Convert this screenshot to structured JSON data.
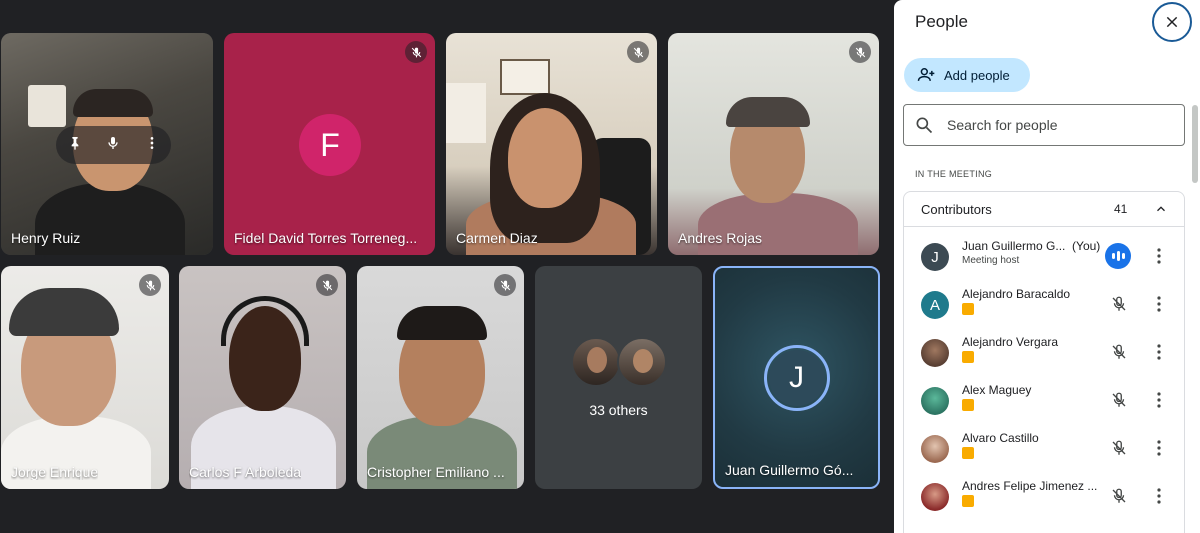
{
  "grid": {
    "tiles": [
      {
        "name": "Henry Ruiz"
      },
      {
        "name": "Fidel David Torres Torreneg...",
        "initial": "F"
      },
      {
        "name": "Carmen Diaz"
      },
      {
        "name": "Andres Rojas"
      },
      {
        "name": "Jorge Enrique"
      },
      {
        "name": "Carlos F Arboleda"
      },
      {
        "name": "Cristopher Emiliano ..."
      },
      {
        "others_label": "33 others"
      },
      {
        "name": "Juan Guillermo Gó...",
        "initial": "J"
      }
    ]
  },
  "panel": {
    "title": "People",
    "add_people_label": "Add people",
    "search_placeholder": "Search for people",
    "section_label": "IN THE MEETING",
    "group": {
      "title": "Contributors",
      "count": "41",
      "people": [
        {
          "name": "Juan Guillermo G...",
          "you": "(You)",
          "sub": "Meeting host",
          "initial": "J"
        },
        {
          "name": "Alejandro Baracaldo",
          "initial": "A"
        },
        {
          "name": "Alejandro Vergara"
        },
        {
          "name": "Alex Maguey"
        },
        {
          "name": "Alvaro Castillo"
        },
        {
          "name": "Andres Felipe Jimenez ..."
        }
      ]
    }
  },
  "colors": {
    "stage_bg": "#202124",
    "tile_bg": "#3c4043",
    "fidel_tile": "#b0204c",
    "fidel_avatar": "#c2185b",
    "accent_blue": "#1a73e8",
    "add_people_bg": "#c2e7ff",
    "self_ring": "#8ab4f8"
  },
  "icons": [
    "mic-off-icon",
    "pin-icon",
    "mic-icon",
    "more-vert-icon",
    "close-icon",
    "person-add-icon",
    "search-icon",
    "chevron-up-icon",
    "speaking-indicator-icon"
  ]
}
